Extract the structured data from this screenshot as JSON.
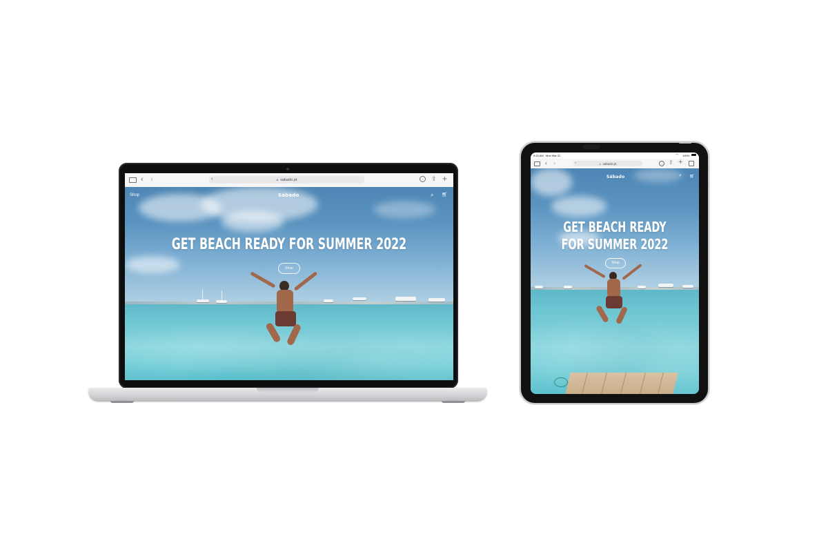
{
  "macbook": {
    "browser": {
      "url": "sabado.pt",
      "icons": [
        "sidebar-icon",
        "back-icon",
        "forward-icon",
        "privacy-shield-icon",
        "lock-icon",
        "download-icon",
        "share-icon",
        "new-tab-icon"
      ]
    },
    "site": {
      "nav_link": "Shop",
      "logo": "Sábado",
      "hero_title": "GET BEACH READY FOR SUMMER 2022",
      "hero_button": "Shop",
      "icons": [
        "search-icon",
        "cart-icon"
      ]
    }
  },
  "ipad": {
    "status": {
      "time": "9:20 AM",
      "date": "Mon Mar 22",
      "battery": "100%"
    },
    "browser": {
      "url": "sabado.pt",
      "icons": [
        "sidebar-icon",
        "back-icon",
        "forward-icon",
        "privacy-shield-icon",
        "lock-icon",
        "download-icon",
        "share-icon",
        "new-tab-icon",
        "tabs-icon"
      ]
    },
    "site": {
      "logo": "Sábado",
      "hero_title_line1": "GET BEACH READY",
      "hero_title_line2": "FOR SUMMER 2022",
      "hero_button": "Shop",
      "icons": [
        "search-icon",
        "cart-icon"
      ]
    }
  },
  "colors": {
    "background": "#ffffff",
    "sky": "#5a93c0",
    "sea": "#7fd0d8",
    "laptop_silver": "#d6d7d9",
    "bezel": "#0e0e0f"
  }
}
